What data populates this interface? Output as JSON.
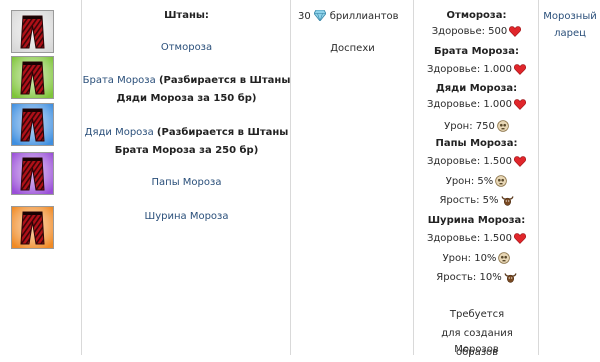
{
  "items": {
    "header": "Штаны:",
    "names": [
      "Отмороза",
      "Брата Мороза",
      "Дяди Мороза",
      "Папы Мороза",
      "Шурина Мороза"
    ],
    "brat_note": "(Разбирается в Штаны Дяди Мороза за 150 бр)",
    "dyadya_note": "(Разбирается в Штаны Брата Мороза за 250 бр)"
  },
  "icons": [
    {
      "name": "pants-grey-icon",
      "bg": "#d8d8d8"
    },
    {
      "name": "pants-green-icon",
      "bg": "#7fc53a"
    },
    {
      "name": "pants-blue-icon",
      "bg": "#3f8fe0"
    },
    {
      "name": "pants-purple-icon",
      "bg": "#9a4fd8"
    },
    {
      "name": "pants-orange-icon",
      "bg": "#f08a25"
    }
  ],
  "price": {
    "amount": "30",
    "currency": "бриллиантов",
    "icon": "diamond-icon"
  },
  "category": "Доспехи",
  "stats": [
    {
      "title": "Отмороза:",
      "health": "Здоровье: 500"
    },
    {
      "title": "Брата Мороза:",
      "health": "Здоровье: 1.000"
    },
    {
      "title": "Дяди Мороза:",
      "health": "Здоровье: 1.000",
      "damage": "Урон: 750"
    },
    {
      "title": "Папы Мороза:",
      "health": "Здоровье: 1.500",
      "damage": "Урон: 5%",
      "rage": "Ярость: 5%"
    },
    {
      "title": "Шурина Мороза:",
      "health": "Здоровье: 1.500",
      "damage": "Урон: 10%",
      "rage": "Ярость: 10%"
    }
  ],
  "stat_icons": {
    "health": "heart-icon",
    "damage": "skull-icon",
    "rage": "bull-icon"
  },
  "requirement": {
    "text": "Требуется для создания образов",
    "link": "Морозов"
  },
  "source": {
    "line1": "Морозный",
    "line2": "ларец"
  },
  "colors": {
    "link": "#2a4f7a",
    "text": "#2b2b2b",
    "heart": "#e0262b",
    "border": "#d9d9d9"
  }
}
